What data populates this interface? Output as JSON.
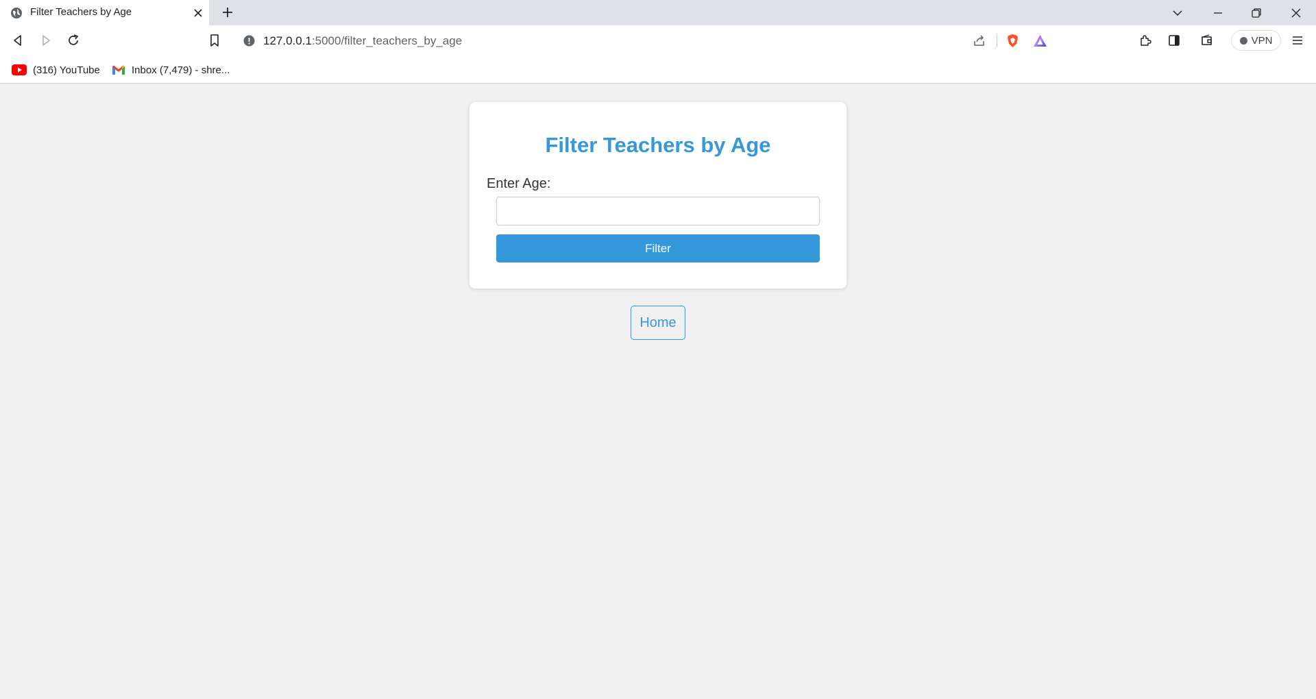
{
  "browser": {
    "tab": {
      "title": "Filter Teachers by Age"
    },
    "address_bar": {
      "host": "127.0.0.1",
      "path": ":5000/filter_teachers_by_age"
    },
    "vpn_label": "VPN",
    "bookmarks": [
      {
        "label": "(316) YouTube",
        "icon": "youtube-icon"
      },
      {
        "label": "Inbox (7,479) - shre...",
        "icon": "gmail-icon"
      }
    ]
  },
  "page": {
    "title": "Filter Teachers by Age",
    "age_label": "Enter Age:",
    "age_input": {
      "value": "",
      "placeholder": ""
    },
    "filter_button": "Filter",
    "home_button": "Home"
  },
  "colors": {
    "accent": "#3498db",
    "page_background": "#f0f0f0"
  }
}
